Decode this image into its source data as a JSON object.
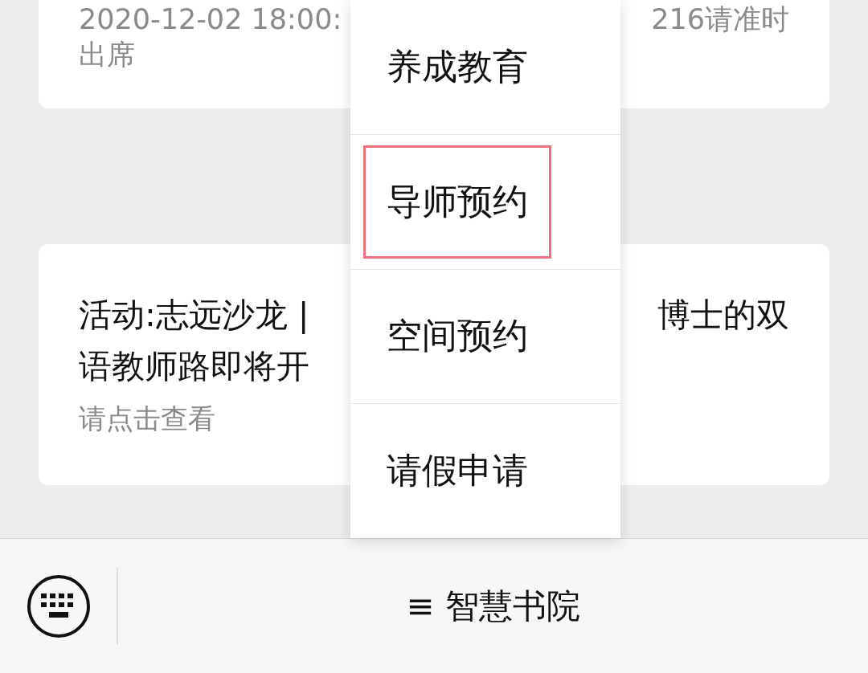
{
  "cards": [
    {
      "detail_parts": [
        "2020-12-02 18:00:",
        "216请准时"
      ],
      "detail_tail": "出席"
    },
    {
      "title_parts": [
        "活动:志远沙龙 |",
        "博士的双"
      ],
      "title_tail": "语教师路即将开",
      "detail_parts": [
        "请点击查看"
      ]
    }
  ],
  "menu": {
    "items": [
      {
        "label": "养成教育",
        "selected": false
      },
      {
        "label": "导师预约",
        "selected": true
      },
      {
        "label": "空间预约",
        "selected": false
      },
      {
        "label": "请假申请",
        "selected": false
      }
    ]
  },
  "bottom_bar": {
    "menu_title": "≡ 智慧书院"
  }
}
